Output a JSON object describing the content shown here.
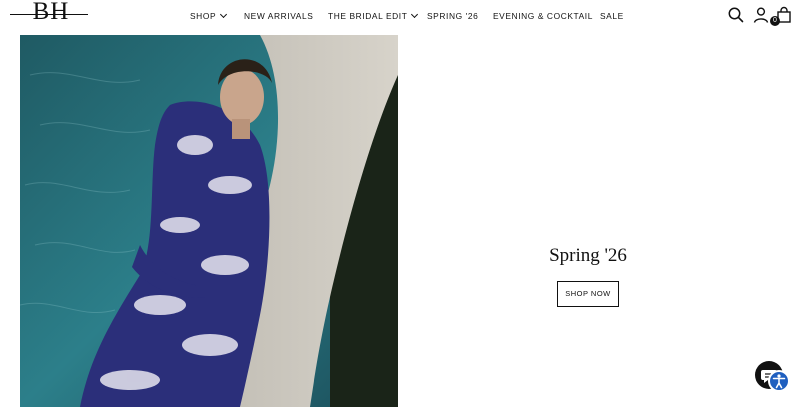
{
  "brand": {
    "logo_text": "BH"
  },
  "nav": {
    "items": [
      {
        "label": "SHOP",
        "has_dropdown": true
      },
      {
        "label": "NEW ARRIVALS",
        "has_dropdown": false
      },
      {
        "label": "THE BRIDAL EDIT",
        "has_dropdown": true
      },
      {
        "label": "SPRING '26",
        "has_dropdown": false
      },
      {
        "label": "EVENING & COCKTAIL",
        "has_dropdown": false
      },
      {
        "label": "SALE",
        "has_dropdown": false
      }
    ]
  },
  "header_icons": {
    "search": "search-icon",
    "account": "user-icon",
    "cart": "shopping-bag-icon",
    "cart_count": "0"
  },
  "promo": {
    "title": "Spring '26",
    "cta_label": "SHOP NOW"
  },
  "widgets": {
    "chat": "chat-icon",
    "accessibility": "accessibility-icon"
  },
  "colors": {
    "text": "#111111",
    "background": "#ffffff",
    "accessibility_blue": "#1f5fbf"
  }
}
